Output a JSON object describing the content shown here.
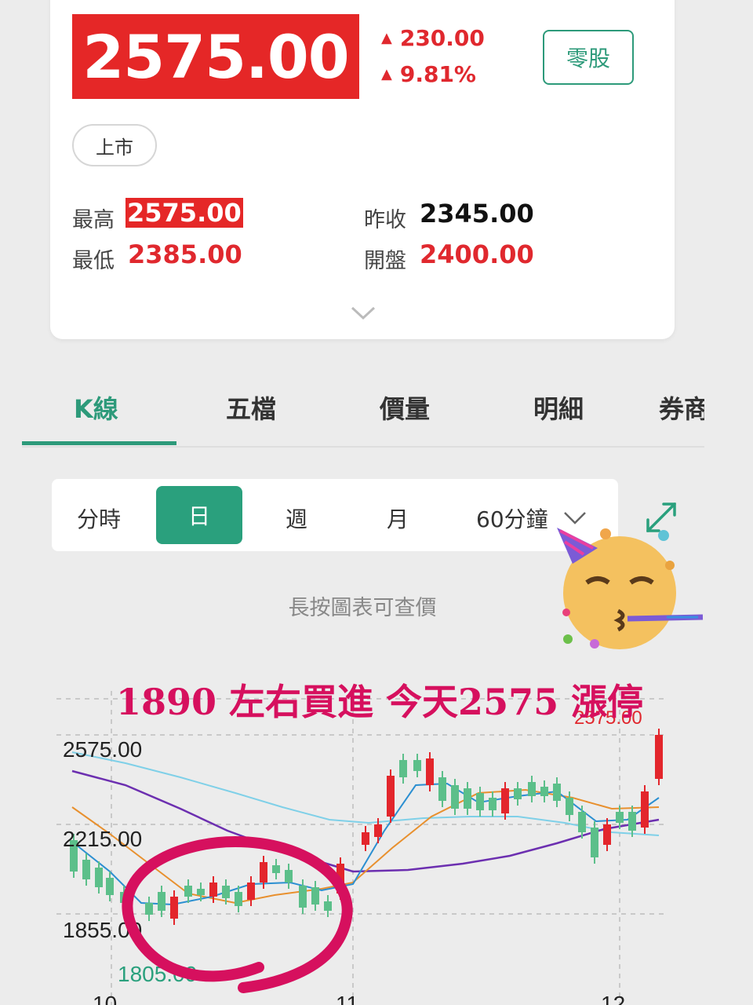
{
  "quote": {
    "price": "2575.00",
    "change": "230.00",
    "change_pct": "9.81%",
    "odd_lot_label": "零股",
    "market_badge": "上市",
    "high_label": "最高",
    "high": "2575.00",
    "low_label": "最低",
    "low": "2385.00",
    "prev_close_label": "昨收",
    "prev_close": "2345.00",
    "open_label": "開盤",
    "open": "2400.00"
  },
  "tabs": [
    "K線",
    "五檔",
    "價量",
    "明細",
    "券商"
  ],
  "periods": {
    "items": [
      "分時",
      "日",
      "週",
      "月",
      "60分鐘"
    ],
    "selected": "日"
  },
  "chart_hint": "長按圖表可查價",
  "annotation": "1890 左右買進  今天2575 漲停",
  "chart_data": {
    "type": "candlestick",
    "y_labels": [
      "2575.00",
      "2215.00",
      "1855.00"
    ],
    "peak_label": "2575.00",
    "low_marker": "1805.00",
    "x_labels": [
      "10",
      "11",
      "12"
    ],
    "overlays": [
      "moving averages (4 lines)"
    ],
    "colors": {
      "up": "#e3262c",
      "down": "#5cbf8a",
      "ma_short": "#2b8fd1",
      "ma_mid": "#e8902e",
      "ma_long": "#6c2fb0",
      "ma_xlong": "#7fd0e8",
      "annotation": "#d6105e"
    }
  },
  "colors": {
    "accent": "#2d9a7a",
    "up": "#e0282e",
    "background": "#ececec"
  },
  "icons": {
    "expand": "chevron-down-icon",
    "fullscreen": "expand-arrows-icon",
    "emoji": "party-face-icon"
  }
}
